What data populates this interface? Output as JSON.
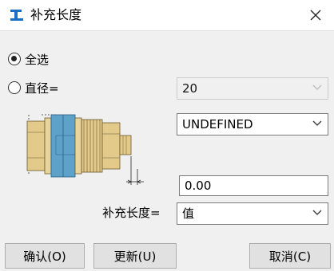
{
  "window": {
    "title": "补充长度",
    "close_glyph": "✕"
  },
  "options": {
    "select_all_label": "全选",
    "diameter_label": "直径="
  },
  "diameter": {
    "value": "20"
  },
  "type_select": {
    "value": "UNDEFINED"
  },
  "length_input": {
    "value": "0.00"
  },
  "supplement": {
    "label": "补充长度=",
    "value": "值"
  },
  "buttons": {
    "confirm": "确认(O)",
    "update": "更新(U)",
    "cancel": "取消(C)"
  },
  "colors": {
    "accent": "#1a6fc4",
    "bolt_body": "#e3c98a",
    "washer_blue": "#5ea2c9"
  }
}
